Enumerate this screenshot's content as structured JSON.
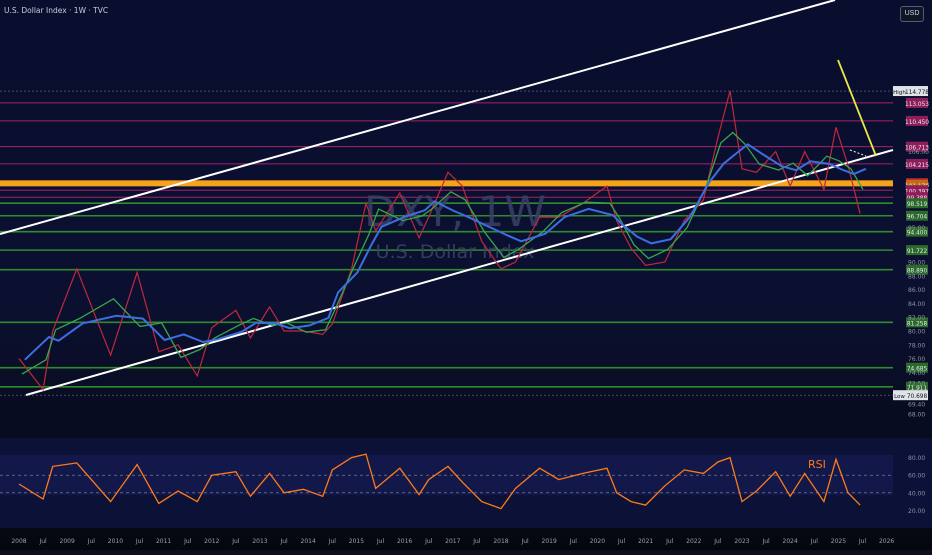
{
  "header": {
    "title": "U.S. Dollar Index · 1W · TVC",
    "currency_button": "USD"
  },
  "watermark": {
    "symbol": "DXY, 1W",
    "name": "U.S. Dollar Index"
  },
  "colors": {
    "background": "#0b0f1e",
    "price": "#c0283c",
    "ma_fast": "#35a84a",
    "ma_slow": "#3b6fe0",
    "support_line": "#2e8b2e",
    "resistance_line": "#a0246a",
    "orange_zone": "#f7a21b",
    "channel": "#ffffff",
    "yellow_trend": "#e8e84a",
    "rsi_line": "#ff7a1a"
  },
  "chart_data": [
    {
      "type": "line",
      "title": "U.S. Dollar Index · 1W · TVC",
      "xlabel": "",
      "ylabel": "",
      "ylim": [
        67,
        118
      ],
      "grid": false,
      "x_ticks": [
        "2008",
        "Jul",
        "2009",
        "Jul",
        "2010",
        "Jul",
        "2011",
        "Jul",
        "2012",
        "Jul",
        "2013",
        "Jul",
        "2014",
        "Jul",
        "2015",
        "Jul",
        "2016",
        "Jul",
        "2017",
        "Jul",
        "2018",
        "Jul",
        "2019",
        "Jul",
        "2020",
        "Jul",
        "2021",
        "Jul",
        "2022",
        "Jul",
        "2023",
        "Jul",
        "2024",
        "Jul",
        "2025",
        "Jul",
        "2026"
      ],
      "y_ticks": [
        68.0,
        69.4,
        72.5,
        74.0,
        76.0,
        78.0,
        80.0,
        82.0,
        84.0,
        86.0,
        88.0,
        90.0,
        95.0,
        106.0
      ],
      "series": [
        {
          "name": "",
          "x": [
            2008.0,
            2008.5,
            2008.7,
            2009.2,
            2009.9,
            2010.45,
            2010.9,
            2011.3,
            2011.7,
            2012.0,
            2012.5,
            2012.8,
            2013.2,
            2013.5,
            2013.9,
            2014.3,
            2014.5,
            2014.9,
            2015.2,
            2015.4,
            2015.9,
            2016.3,
            2016.5,
            2016.9,
            2017.2,
            2017.6,
            2018.0,
            2018.3,
            2018.8,
            2019.2,
            2019.7,
            2020.2,
            2020.4,
            2020.7,
            2021.0,
            2021.4,
            2021.8,
            2022.2,
            2022.5,
            2022.75,
            2023.0,
            2023.3,
            2023.7,
            2024.0,
            2024.3,
            2024.7,
            2024.95,
            2025.2,
            2025.45
          ],
          "values": [
            76.0,
            71.5,
            80.0,
            89.0,
            76.5,
            88.5,
            77.0,
            78.0,
            73.5,
            80.5,
            83.0,
            79.0,
            83.5,
            80.0,
            80.0,
            79.5,
            81.0,
            89.0,
            98.5,
            94.5,
            100.0,
            93.5,
            96.5,
            103.0,
            101.0,
            93.0,
            89.0,
            90.0,
            96.5,
            96.5,
            98.5,
            101.0,
            96.0,
            92.0,
            89.5,
            90.0,
            96.0,
            99.0,
            108.0,
            114.8,
            103.5,
            103.0,
            106.0,
            101.0,
            106.0,
            100.5,
            109.5,
            104.0,
            97.0
          ]
        },
        {
          "name": "RSI",
          "x": [
            2008.0,
            2008.5,
            2008.7,
            2009.2,
            2009.9,
            2010.45,
            2010.9,
            2011.3,
            2011.7,
            2012.0,
            2012.5,
            2012.8,
            2013.2,
            2013.5,
            2013.9,
            2014.3,
            2014.5,
            2014.9,
            2015.2,
            2015.4,
            2015.9,
            2016.3,
            2016.5,
            2016.9,
            2017.2,
            2017.6,
            2018.0,
            2018.3,
            2018.8,
            2019.2,
            2019.7,
            2020.2,
            2020.4,
            2020.7,
            2021.0,
            2021.4,
            2021.8,
            2022.2,
            2022.5,
            2022.75,
            2023.0,
            2023.3,
            2023.7,
            2024.0,
            2024.3,
            2024.7,
            2024.95,
            2025.2,
            2025.45
          ],
          "values": [
            50,
            33,
            70,
            74,
            30,
            72,
            28,
            42,
            30,
            60,
            64,
            36,
            62,
            40,
            44,
            36,
            66,
            80,
            84,
            45,
            68,
            38,
            55,
            70,
            52,
            30,
            22,
            45,
            68,
            55,
            62,
            68,
            40,
            30,
            26,
            48,
            66,
            62,
            75,
            80,
            30,
            42,
            64,
            36,
            62,
            30,
            78,
            40,
            26
          ]
        }
      ]
    }
  ],
  "levels": [
    {
      "label": "High",
      "value": "114.778",
      "kind": "high"
    },
    {
      "value": "113.053",
      "kind": "resistance"
    },
    {
      "value": "110.450",
      "kind": "resistance"
    },
    {
      "value": "106.713",
      "kind": "resistance"
    },
    {
      "value": "104.215",
      "kind": "resistance"
    },
    {
      "value": "101.408",
      "kind": "price"
    },
    {
      "value": "101.179",
      "kind": "price-alt"
    },
    {
      "value": "100.397",
      "kind": "resistance"
    },
    {
      "value": "99.388",
      "kind": "resistance"
    },
    {
      "value": "98.519",
      "kind": "support"
    },
    {
      "value": "96.704",
      "kind": "support"
    },
    {
      "value": "94.400",
      "kind": "support"
    },
    {
      "value": "91.722",
      "kind": "support"
    },
    {
      "value": "88.890",
      "kind": "support"
    },
    {
      "value": "81.258",
      "kind": "support"
    },
    {
      "value": "74.685",
      "kind": "support"
    },
    {
      "value": "71.911",
      "kind": "support"
    },
    {
      "label": "Low",
      "value": "70.698",
      "kind": "low"
    }
  ],
  "rsi": {
    "label": "RSI",
    "ticks": [
      "80.00",
      "60.00",
      "40.00",
      "20.00"
    ]
  }
}
